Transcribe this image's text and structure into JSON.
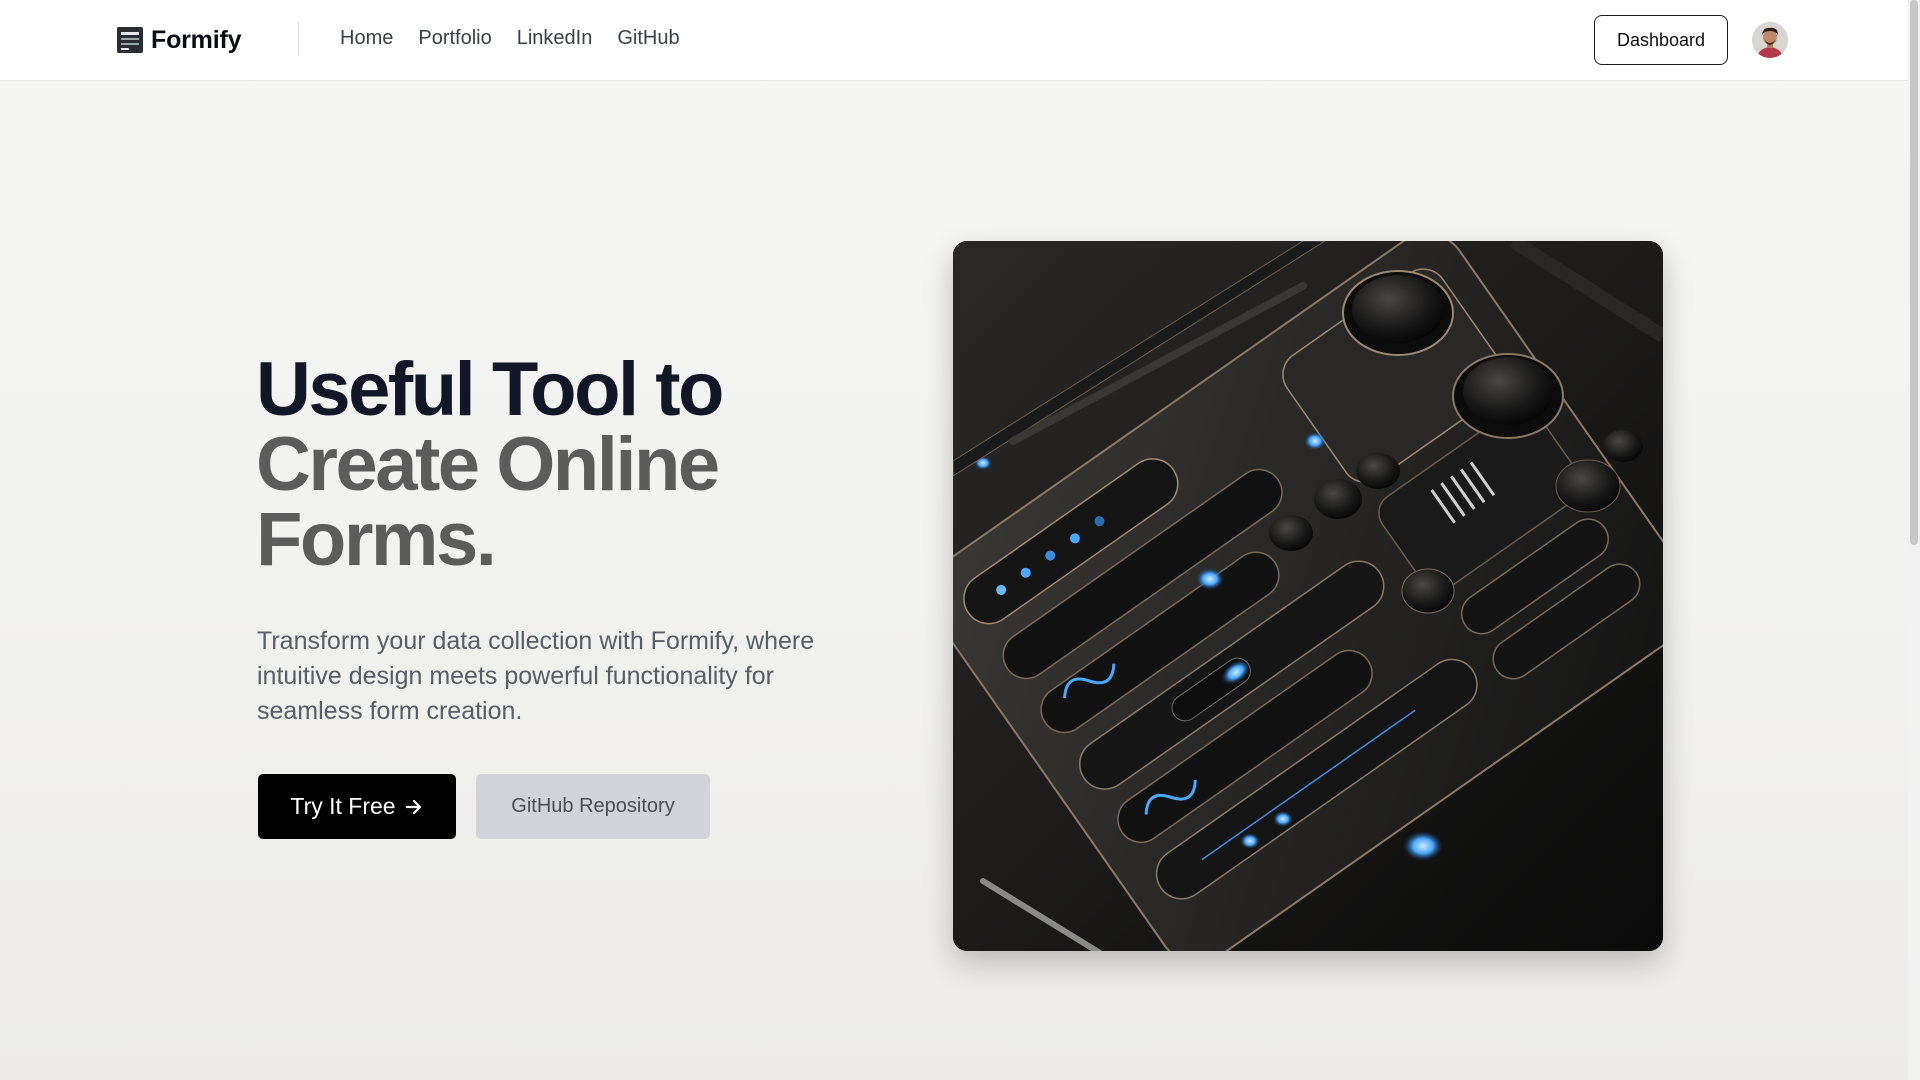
{
  "header": {
    "brand": "Formify",
    "nav": [
      "Home",
      "Portfolio",
      "LinkedIn",
      "GitHub"
    ],
    "dashboard_label": "Dashboard"
  },
  "hero": {
    "title_line1": "Useful Tool to",
    "title_line2": "Create Online",
    "title_line3": "Forms.",
    "subtitle": "Transform your data collection with Formify, where intuitive design meets powerful functionality for seamless form creation.",
    "primary_cta": "Try It Free",
    "secondary_cta": "GitHub Repository"
  },
  "colors": {
    "title_dark": "#111726",
    "title_grey": "#5c5c5c",
    "primary_button": "#000000",
    "secondary_button": "#d1d3d9",
    "accent_glow": "#4aa8ff"
  },
  "icons": {
    "logo": "form-icon",
    "arrow": "arrow-right-icon"
  }
}
